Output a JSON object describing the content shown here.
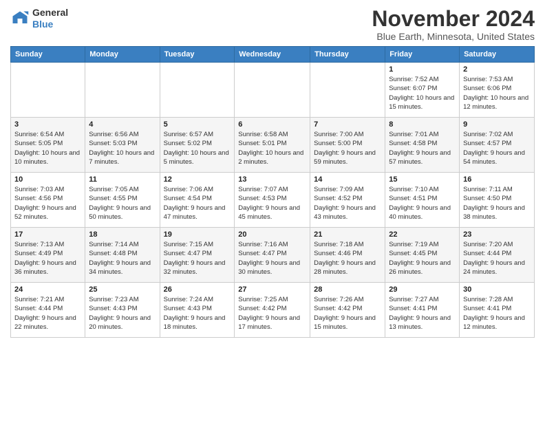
{
  "logo": {
    "general": "General",
    "blue": "Blue"
  },
  "header": {
    "month": "November 2024",
    "location": "Blue Earth, Minnesota, United States"
  },
  "weekdays": [
    "Sunday",
    "Monday",
    "Tuesday",
    "Wednesday",
    "Thursday",
    "Friday",
    "Saturday"
  ],
  "weeks": [
    [
      {
        "day": "",
        "info": ""
      },
      {
        "day": "",
        "info": ""
      },
      {
        "day": "",
        "info": ""
      },
      {
        "day": "",
        "info": ""
      },
      {
        "day": "",
        "info": ""
      },
      {
        "day": "1",
        "info": "Sunrise: 7:52 AM\nSunset: 6:07 PM\nDaylight: 10 hours and 15 minutes."
      },
      {
        "day": "2",
        "info": "Sunrise: 7:53 AM\nSunset: 6:06 PM\nDaylight: 10 hours and 12 minutes."
      }
    ],
    [
      {
        "day": "3",
        "info": "Sunrise: 6:54 AM\nSunset: 5:05 PM\nDaylight: 10 hours and 10 minutes."
      },
      {
        "day": "4",
        "info": "Sunrise: 6:56 AM\nSunset: 5:03 PM\nDaylight: 10 hours and 7 minutes."
      },
      {
        "day": "5",
        "info": "Sunrise: 6:57 AM\nSunset: 5:02 PM\nDaylight: 10 hours and 5 minutes."
      },
      {
        "day": "6",
        "info": "Sunrise: 6:58 AM\nSunset: 5:01 PM\nDaylight: 10 hours and 2 minutes."
      },
      {
        "day": "7",
        "info": "Sunrise: 7:00 AM\nSunset: 5:00 PM\nDaylight: 9 hours and 59 minutes."
      },
      {
        "day": "8",
        "info": "Sunrise: 7:01 AM\nSunset: 4:58 PM\nDaylight: 9 hours and 57 minutes."
      },
      {
        "day": "9",
        "info": "Sunrise: 7:02 AM\nSunset: 4:57 PM\nDaylight: 9 hours and 54 minutes."
      }
    ],
    [
      {
        "day": "10",
        "info": "Sunrise: 7:03 AM\nSunset: 4:56 PM\nDaylight: 9 hours and 52 minutes."
      },
      {
        "day": "11",
        "info": "Sunrise: 7:05 AM\nSunset: 4:55 PM\nDaylight: 9 hours and 50 minutes."
      },
      {
        "day": "12",
        "info": "Sunrise: 7:06 AM\nSunset: 4:54 PM\nDaylight: 9 hours and 47 minutes."
      },
      {
        "day": "13",
        "info": "Sunrise: 7:07 AM\nSunset: 4:53 PM\nDaylight: 9 hours and 45 minutes."
      },
      {
        "day": "14",
        "info": "Sunrise: 7:09 AM\nSunset: 4:52 PM\nDaylight: 9 hours and 43 minutes."
      },
      {
        "day": "15",
        "info": "Sunrise: 7:10 AM\nSunset: 4:51 PM\nDaylight: 9 hours and 40 minutes."
      },
      {
        "day": "16",
        "info": "Sunrise: 7:11 AM\nSunset: 4:50 PM\nDaylight: 9 hours and 38 minutes."
      }
    ],
    [
      {
        "day": "17",
        "info": "Sunrise: 7:13 AM\nSunset: 4:49 PM\nDaylight: 9 hours and 36 minutes."
      },
      {
        "day": "18",
        "info": "Sunrise: 7:14 AM\nSunset: 4:48 PM\nDaylight: 9 hours and 34 minutes."
      },
      {
        "day": "19",
        "info": "Sunrise: 7:15 AM\nSunset: 4:47 PM\nDaylight: 9 hours and 32 minutes."
      },
      {
        "day": "20",
        "info": "Sunrise: 7:16 AM\nSunset: 4:47 PM\nDaylight: 9 hours and 30 minutes."
      },
      {
        "day": "21",
        "info": "Sunrise: 7:18 AM\nSunset: 4:46 PM\nDaylight: 9 hours and 28 minutes."
      },
      {
        "day": "22",
        "info": "Sunrise: 7:19 AM\nSunset: 4:45 PM\nDaylight: 9 hours and 26 minutes."
      },
      {
        "day": "23",
        "info": "Sunrise: 7:20 AM\nSunset: 4:44 PM\nDaylight: 9 hours and 24 minutes."
      }
    ],
    [
      {
        "day": "24",
        "info": "Sunrise: 7:21 AM\nSunset: 4:44 PM\nDaylight: 9 hours and 22 minutes."
      },
      {
        "day": "25",
        "info": "Sunrise: 7:23 AM\nSunset: 4:43 PM\nDaylight: 9 hours and 20 minutes."
      },
      {
        "day": "26",
        "info": "Sunrise: 7:24 AM\nSunset: 4:43 PM\nDaylight: 9 hours and 18 minutes."
      },
      {
        "day": "27",
        "info": "Sunrise: 7:25 AM\nSunset: 4:42 PM\nDaylight: 9 hours and 17 minutes."
      },
      {
        "day": "28",
        "info": "Sunrise: 7:26 AM\nSunset: 4:42 PM\nDaylight: 9 hours and 15 minutes."
      },
      {
        "day": "29",
        "info": "Sunrise: 7:27 AM\nSunset: 4:41 PM\nDaylight: 9 hours and 13 minutes."
      },
      {
        "day": "30",
        "info": "Sunrise: 7:28 AM\nSunset: 4:41 PM\nDaylight: 9 hours and 12 minutes."
      }
    ]
  ]
}
